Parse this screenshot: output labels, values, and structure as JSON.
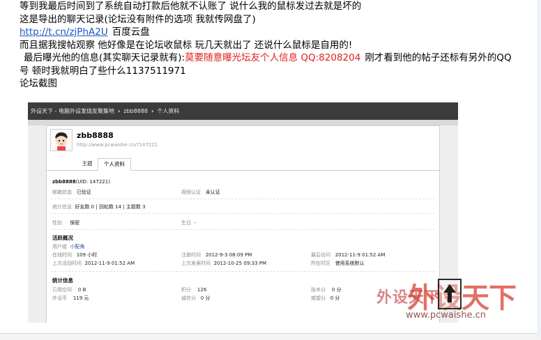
{
  "post": {
    "line1": "等到我最后时间到了系统自动打款后他就不认账了 说什么我的鼠标发过去就是坏的",
    "line2": "这是导出的聊天记录(论坛没有附件的选项 我就传网盘了)",
    "link": "http://t.cn/zjPhA2U",
    "link_label": "百度云盘",
    "line4": "而且据我搜帖观察 他好像是在论坛收鼠标 玩几天就出了  还说什么鼠标是自用的!",
    "line5_prefix": "最后曝光他的信息(其实聊天记录就有):",
    "line5_red": "莫要随意曝光坛友个人信息  QQ:8208204",
    "line5_suffix": "刚才看到他的帖子还标有另外的QQ",
    "line6": "号  顿时我就明白了些什么1137511971",
    "line7": "论坛截图"
  },
  "screenshot": {
    "breadcrumb": [
      "外设天下 - 电脑外设发烧友聚集地",
      "zbb8888",
      "个人资料"
    ],
    "username": "zbb8888",
    "profile_url": "http://www.pcwaishe.cn/?147221",
    "tabs": [
      "主题",
      "个人资料"
    ],
    "uid_name": "zbb8888",
    "uid_text": "(UID: 147221)",
    "email_label": "邮箱状态",
    "email_value": "已验证",
    "video_label": "视频认证",
    "video_value": "未认证",
    "stats_label": "统计信息",
    "stats_value": "好友数 0  |  回帖数 14  |  主题数 3",
    "gender_label": "性别",
    "gender_value": "保密",
    "birthday_label": "生日",
    "birthday_value": "-",
    "activity_title": "活跃概况",
    "group_label": "用户组",
    "group_value": "小配角",
    "online_label": "在线时间",
    "online_value": "109 小时",
    "reg_label": "注册时间",
    "reg_value": "2012-9-3 08:09 PM",
    "last_visit_label": "最后访问",
    "last_visit_value": "2012-11-9 01:52 AM",
    "last_active_label": "上次活动时间",
    "last_active_value": "2012-11-9 01:52 AM",
    "last_post_label": "上次发表时间",
    "last_post_value": "2012-10-25 09:33 PM",
    "tz_label": "所在时区",
    "tz_value": "使用系统默认",
    "stat_title": "统计信息",
    "space_label": "已用空间",
    "space_value": "0 B",
    "points_label": "积分",
    "points_value": "126",
    "tech_label": "技术分",
    "tech_value": "0 分",
    "coin_label": "外设币",
    "coin_value": "119 元",
    "honesty_label": "诚信分",
    "honesty_value": "0 分",
    "fame_label": "威望分",
    "fame_value": "0 分"
  },
  "watermark": {
    "small": "外设天下",
    "big": "外设天下",
    "url": "www.pcwaishe.cn"
  },
  "icons": {
    "avatar": "cartoon-avatar-icon",
    "cursor": "upload-cursor-icon"
  },
  "colors": {
    "link": "#1a56c4",
    "warning_red": "#e02020",
    "watermark_red": "#d83a2a",
    "bar_dark": "#3b3b3b"
  }
}
